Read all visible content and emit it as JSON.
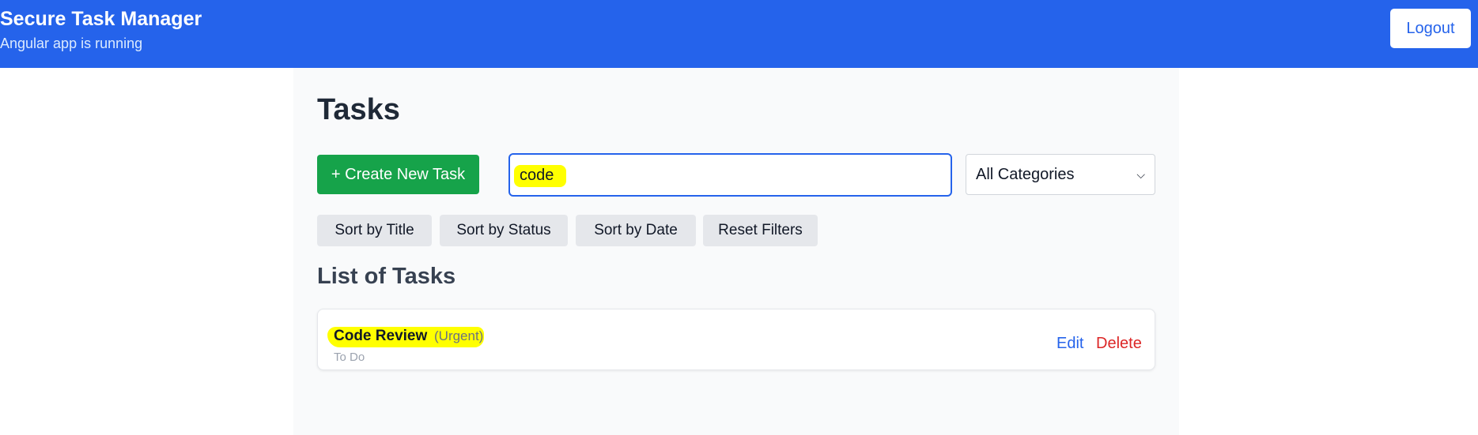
{
  "header": {
    "title": "Secure Task Manager",
    "subtitle": "Angular app is running",
    "logout_label": "Logout"
  },
  "main": {
    "title": "Tasks",
    "create_label": "+ Create New Task",
    "search": {
      "value": "code",
      "placeholder": ""
    },
    "category": {
      "selected": "All Categories"
    },
    "sort_buttons": [
      "Sort by Title",
      "Sort by Status",
      "Sort by Date",
      "Reset Filters"
    ],
    "list_title": "List of Tasks",
    "tasks": [
      {
        "title": "Code Review",
        "tag": "(Urgent)",
        "status": "To Do",
        "edit_label": "Edit",
        "delete_label": "Delete"
      }
    ]
  },
  "colors": {
    "header_bg": "#2563eb",
    "create_button": "#16a34a",
    "edit_link": "#2563eb",
    "delete_link": "#dc2626",
    "highlight": "#ffff00"
  }
}
